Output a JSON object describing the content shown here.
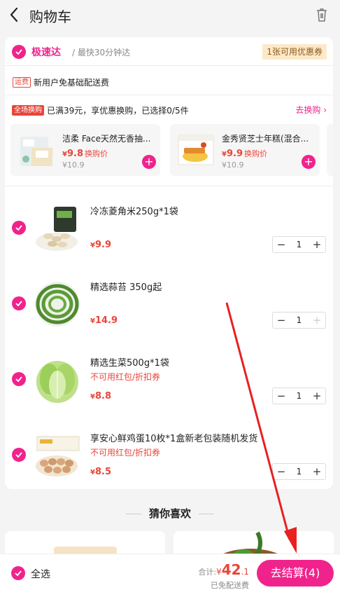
{
  "header": {
    "title": "购物车"
  },
  "store": {
    "name": "极速达",
    "time": "/ 最快30分钟达",
    "coupon": "1张可用优惠券",
    "ship_tag": "运费",
    "ship_text": "新用户免基础配送费"
  },
  "swap": {
    "tag": "全场换购",
    "text": "已满39元，享优惠换购，已选择0/5件",
    "link": "去换购",
    "items": [
      {
        "name": "洁柔 Face天然无香抽...",
        "currency": "¥",
        "price": "9.8",
        "price_tag": "换购价",
        "orig": "¥10.9"
      },
      {
        "name": "金秀贤芝士年糕(混合...",
        "currency": "¥",
        "price": "9.9",
        "price_tag": "换购价",
        "orig": "¥10.9"
      }
    ]
  },
  "items": [
    {
      "name": "冷冻菱角米250g*1袋",
      "warn": "",
      "currency": "¥",
      "price": "9.9",
      "qty": "1"
    },
    {
      "name": "精选蒜苔 350g起",
      "warn": "",
      "currency": "¥",
      "price": "14.9",
      "qty": "1"
    },
    {
      "name": "精选生菜500g*1袋",
      "warn": "不可用红包/折扣券",
      "currency": "¥",
      "price": "8.8",
      "qty": "1"
    },
    {
      "name": "享安心鲜鸡蛋10枚*1盒新老包装随机发货",
      "warn": "不可用红包/折扣券",
      "currency": "¥",
      "price": "8.5",
      "qty": "1"
    }
  ],
  "recommend": {
    "title": "猜你喜欢"
  },
  "footer": {
    "select_all": "全选",
    "total_label": "合计:",
    "currency": "¥",
    "total_int": "42",
    "total_dec": ".1",
    "free_ship": "已免配送费",
    "checkout": "去结算(4)"
  },
  "colors": {
    "accent": "#f0238c",
    "price": "#e8463a",
    "coupon_bg": "#fde9c9"
  }
}
